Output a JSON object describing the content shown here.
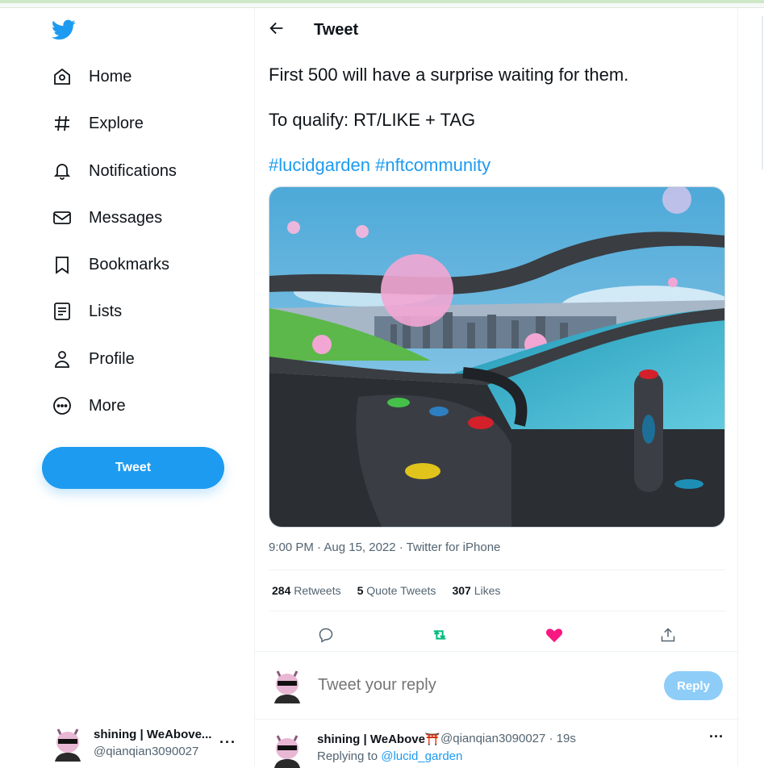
{
  "sidebar": {
    "nav": [
      {
        "label": "Home",
        "icon": "home-icon"
      },
      {
        "label": "Explore",
        "icon": "hashtag-icon"
      },
      {
        "label": "Notifications",
        "icon": "bell-icon"
      },
      {
        "label": "Messages",
        "icon": "envelope-icon"
      },
      {
        "label": "Bookmarks",
        "icon": "bookmark-icon"
      },
      {
        "label": "Lists",
        "icon": "list-icon"
      },
      {
        "label": "Profile",
        "icon": "person-icon"
      },
      {
        "label": "More",
        "icon": "more-circle-icon"
      }
    ],
    "tweet_button": "Tweet",
    "account": {
      "name": "shining | WeAbove...",
      "handle": "@qianqian3090027"
    }
  },
  "header": {
    "title": "Tweet"
  },
  "tweet": {
    "line1": "First 500 will have a surprise waiting for them.",
    "line2": "To qualify: RT/LIKE + TAG",
    "hashtags": "#lucidgarden #nftcommunity",
    "meta": "9:00 PM · Aug 15, 2022 · Twitter for iPhone",
    "stats": {
      "retweets": "284",
      "retweets_label": "Retweets",
      "quotes": "5",
      "quotes_label": "Quote Tweets",
      "likes": "307",
      "likes_label": "Likes"
    }
  },
  "reply_box": {
    "placeholder": "Tweet your reply",
    "button": "Reply"
  },
  "comment": {
    "name": "shining | WeAbove⛩️",
    "handle": "@qianqian3090027 · 19s",
    "replying_prefix": "Replying to",
    "replying_to": "@lucid_garden"
  },
  "colors": {
    "accent": "#1d9bf0",
    "retweet_active": "#00ba7c",
    "like_active": "#f91880"
  }
}
